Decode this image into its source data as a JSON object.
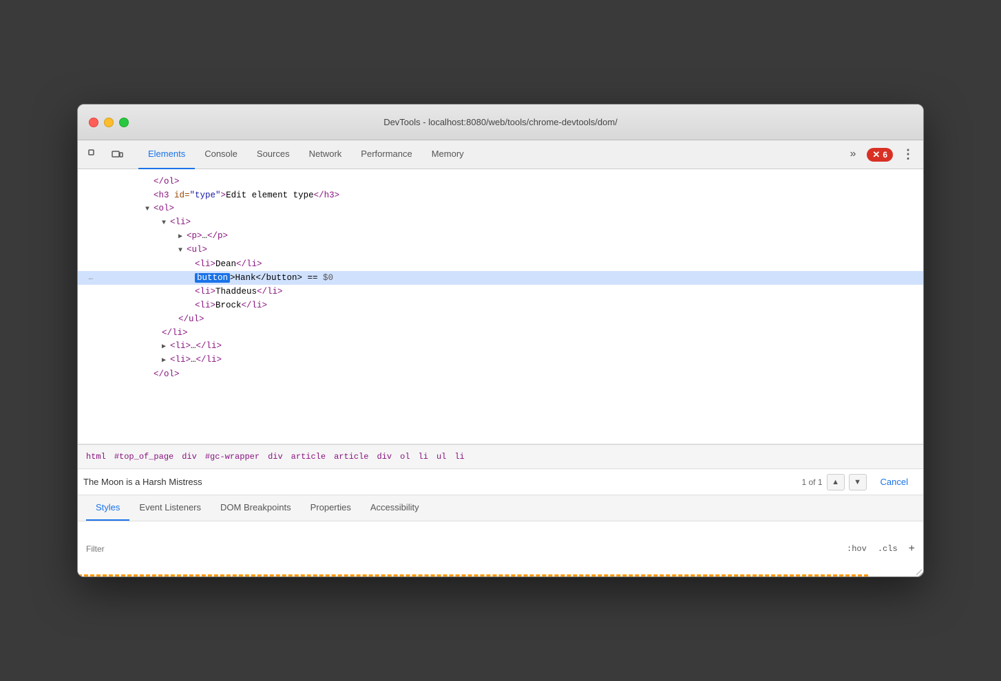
{
  "window": {
    "title": "DevTools - localhost:8080/web/tools/chrome-devtools/dom/"
  },
  "tabs": {
    "main": [
      {
        "label": "Elements",
        "active": true
      },
      {
        "label": "Console",
        "active": false
      },
      {
        "label": "Sources",
        "active": false
      },
      {
        "label": "Network",
        "active": false
      },
      {
        "label": "Performance",
        "active": false
      },
      {
        "label": "Memory",
        "active": false
      }
    ],
    "more": "»",
    "error_count": "6"
  },
  "dom_lines": [
    {
      "indent": 4,
      "content": "</ol>",
      "type": "closing"
    },
    {
      "indent": 4,
      "content": "<h3 id=\"type\">Edit element type</h3>",
      "type": "normal"
    },
    {
      "indent": 4,
      "content": "▼<ol>",
      "type": "triangle-open"
    },
    {
      "indent": 6,
      "content": "▼<li>",
      "type": "triangle-open"
    },
    {
      "indent": 8,
      "content": "▶<p>…</p>",
      "type": "triangle-closed"
    },
    {
      "indent": 8,
      "content": "▼<ul>",
      "type": "triangle-open"
    },
    {
      "indent": 10,
      "content": "<li>Dean</li>",
      "type": "normal"
    },
    {
      "indent": 10,
      "content": "button_hank",
      "type": "selected"
    },
    {
      "indent": 10,
      "content": "<li>Thaddeus</li>",
      "type": "normal"
    },
    {
      "indent": 10,
      "content": "<li>Brock</li>",
      "type": "normal"
    },
    {
      "indent": 8,
      "content": "</ul>",
      "type": "closing"
    },
    {
      "indent": 6,
      "content": "</li>",
      "type": "closing"
    },
    {
      "indent": 6,
      "content": "▶<li>…</li>",
      "type": "triangle-closed2"
    },
    {
      "indent": 6,
      "content": "▶<li>…</li>",
      "type": "triangle-closed3"
    },
    {
      "indent": 4,
      "content": "</ol>",
      "type": "closing2"
    }
  ],
  "breadcrumb": {
    "items": [
      "html",
      "#top_of_page",
      "div",
      "#gc-wrapper",
      "div",
      "article",
      "article",
      "div",
      "ol",
      "li",
      "ul",
      "li"
    ]
  },
  "search": {
    "placeholder": "The Moon is a Harsh Mistress",
    "count": "1 of 1",
    "cancel_label": "Cancel"
  },
  "bottom_tabs": [
    {
      "label": "Styles",
      "active": true
    },
    {
      "label": "Event Listeners",
      "active": false
    },
    {
      "label": "DOM Breakpoints",
      "active": false
    },
    {
      "label": "Properties",
      "active": false
    },
    {
      "label": "Accessibility",
      "active": false
    }
  ],
  "styles": {
    "filter_placeholder": "Filter",
    "hov_label": ":hov",
    "cls_label": ".cls",
    "plus_label": "+"
  }
}
